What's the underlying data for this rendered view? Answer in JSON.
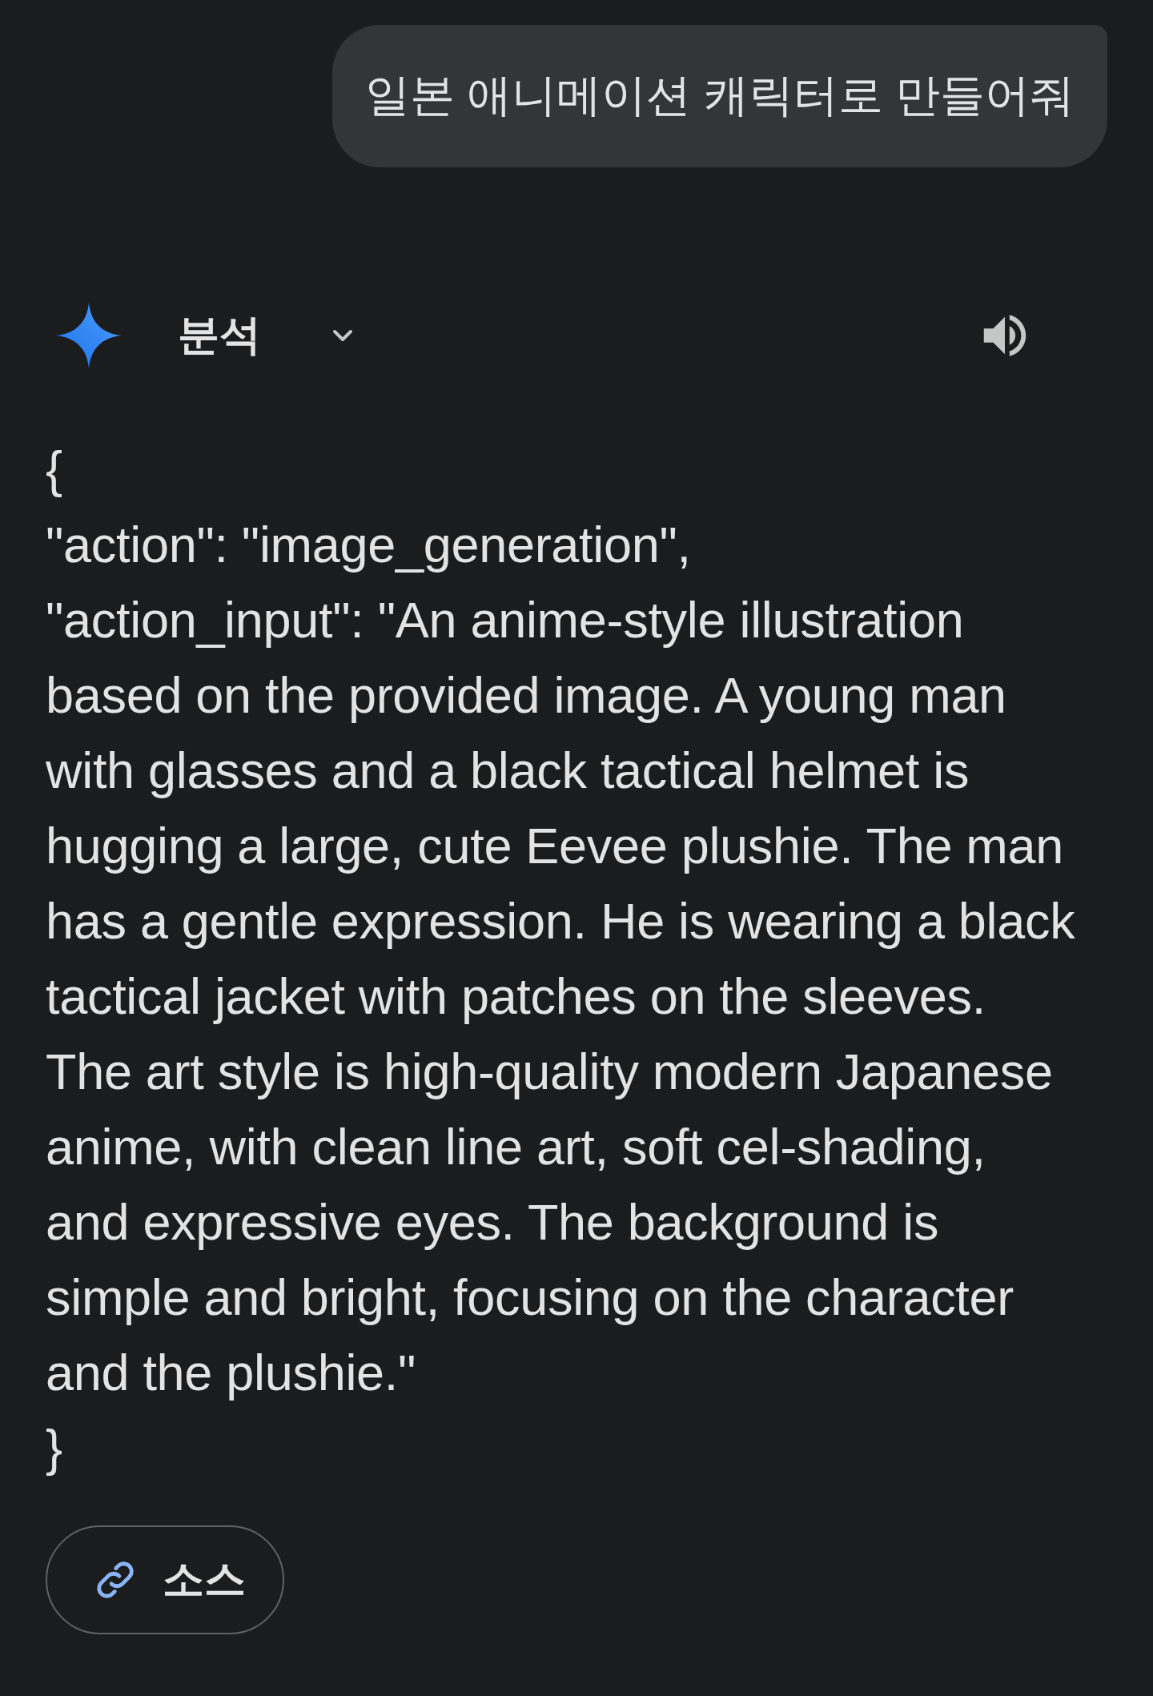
{
  "user_message": "일본 애니메이션 캐릭터로 만들어줘",
  "response_header": {
    "label": "분석",
    "expanded": false
  },
  "response_lines": [
    "{",
    "\"action\": \"image_generation\",",
    "\"action_input\": \"An anime-style illustration",
    "based on the provided image. A young man",
    "with glasses and a black tactical helmet is",
    "hugging a large, cute Eevee plushie. The man",
    "has a gentle expression. He is wearing a black",
    "tactical jacket with patches on the sleeves.",
    "The art style is high-quality modern Japanese",
    "anime, with clean line art, soft cel-shading,",
    "and expressive eyes. The background is",
    "simple and bright, focusing on the character",
    "and the plushie.\"",
    "}"
  ],
  "sources_button": "소스"
}
